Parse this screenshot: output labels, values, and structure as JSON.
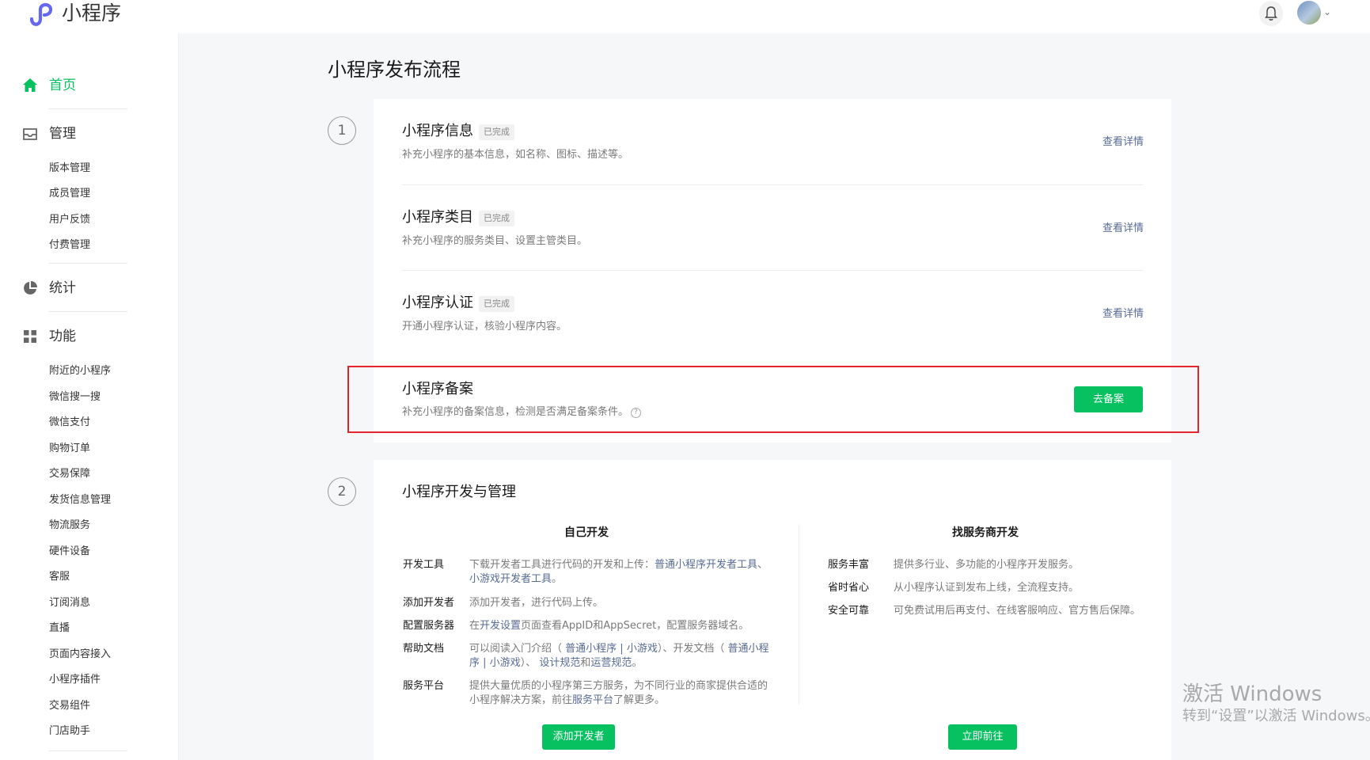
{
  "header": {
    "app_name": "小程序",
    "logo_icon": "miniprogram-logo-icon",
    "notification_icon": "bell-icon",
    "avatar_menu_icon": "chevron-down-icon"
  },
  "sidebar": {
    "home": {
      "label": "首页",
      "icon": "home-icon"
    },
    "manage": {
      "label": "管理",
      "icon": "inbox-icon",
      "items": [
        "版本管理",
        "成员管理",
        "用户反馈",
        "付费管理"
      ]
    },
    "stats": {
      "label": "统计",
      "icon": "pie-chart-icon"
    },
    "features": {
      "label": "功能",
      "icon": "grid-icon",
      "items": [
        "附近的小程序",
        "微信搜一搜",
        "微信支付",
        "购物订单",
        "交易保障",
        "发货信息管理",
        "物流服务",
        "硬件设备",
        "客服",
        "订阅消息",
        "直播",
        "页面内容接入",
        "小程序插件",
        "交易组件",
        "门店助手"
      ]
    }
  },
  "main": {
    "page_title": "小程序发布流程",
    "step1": {
      "number": "1",
      "items": [
        {
          "title": "小程序信息",
          "badge": "已完成",
          "desc": "补充小程序的基本信息，如名称、图标、描述等。",
          "action": "查看详情"
        },
        {
          "title": "小程序类目",
          "badge": "已完成",
          "desc": "补充小程序的服务类目、设置主管类目。",
          "action": "查看详情"
        },
        {
          "title": "小程序认证",
          "badge": "已完成",
          "desc": "开通小程序认证，核验小程序内容。",
          "action": "查看详情"
        },
        {
          "title": "小程序备案",
          "desc": "补充小程序的备案信息，检测是否满足备案条件。",
          "help_icon": "question-circle-icon",
          "action": "去备案"
        }
      ]
    },
    "step2": {
      "number": "2",
      "title": "小程序开发与管理",
      "self_dev": {
        "heading": "自己开发",
        "rows": [
          {
            "label": "开发工具",
            "parts": [
              "下载开发者工具进行代码的开发和上传：",
              "普通小程序开发者工具",
              "、",
              "小游戏开发者工具",
              "。"
            ]
          },
          {
            "label": "添加开发者",
            "parts": [
              "添加开发者，进行代码上传。"
            ]
          },
          {
            "label": "配置服务器",
            "parts": [
              "在",
              "开发设置",
              "页面查看AppID和AppSecret，配置服务器域名。"
            ]
          },
          {
            "label": "帮助文档",
            "parts": [
              "可以阅读入门介绍（ ",
              "普通小程序",
              " | ",
              "小游戏",
              "）、开发文档（ ",
              "普通小程序",
              " | ",
              "小游戏",
              "）、 ",
              "设计规范",
              "和",
              "运营规范",
              "。"
            ]
          },
          {
            "label": "服务平台",
            "parts": [
              "提供大量优质的小程序第三方服务，为不同行业的商家提供合适的小程序解决方案，前往",
              "服务平台",
              "了解更多。"
            ]
          }
        ],
        "button": "添加开发者"
      },
      "provider_dev": {
        "heading": "找服务商开发",
        "rows": [
          {
            "label": "服务丰富",
            "text": "提供多行业、多功能的小程序开发服务。"
          },
          {
            "label": "省时省心",
            "text": "从小程序认证到发布上线，全流程支持。"
          },
          {
            "label": "安全可靠",
            "text": "可免费试用后再支付、在线客服响应、官方售后保障。"
          }
        ],
        "button": "立即前往"
      }
    }
  },
  "watermark": {
    "line1": "激活 Windows",
    "line2": "转到“设置”以激活 Windows。"
  },
  "colors": {
    "accent": "#07c160",
    "link": "#576b95",
    "highlight": "#e5242b"
  }
}
